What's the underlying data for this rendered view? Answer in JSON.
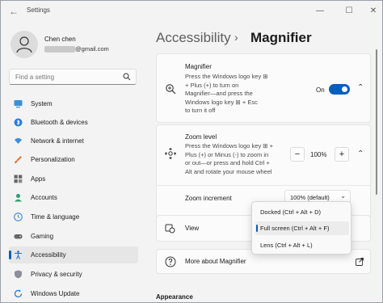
{
  "window": {
    "title": "Settings",
    "back_icon": "back-arrow-icon",
    "controls": [
      "minimize-icon",
      "maximize-icon",
      "close-icon"
    ]
  },
  "profile": {
    "name": "Chen chen",
    "email_suffix": "@gmail.com"
  },
  "search": {
    "placeholder": "Find a setting"
  },
  "nav": {
    "items": [
      {
        "label": "System",
        "icon": "monitor-icon"
      },
      {
        "label": "Bluetooth & devices",
        "icon": "bluetooth-icon"
      },
      {
        "label": "Network & internet",
        "icon": "wifi-icon"
      },
      {
        "label": "Personalization",
        "icon": "paintbrush-icon"
      },
      {
        "label": "Apps",
        "icon": "apps-icon"
      },
      {
        "label": "Accounts",
        "icon": "person-icon"
      },
      {
        "label": "Time & language",
        "icon": "globe-clock-icon"
      },
      {
        "label": "Gaming",
        "icon": "gamepad-icon"
      },
      {
        "label": "Accessibility",
        "icon": "accessibility-icon"
      },
      {
        "label": "Privacy & security",
        "icon": "shield-icon"
      },
      {
        "label": "Windows Update",
        "icon": "update-icon"
      }
    ],
    "active_index": 8
  },
  "breadcrumb": {
    "parent": "Accessibility",
    "separator": "›",
    "current": "Magnifier"
  },
  "magnifier": {
    "title": "Magnifier",
    "desc_lines": [
      "Press the Windows logo key ⊞",
      "+ Plus (+) to turn on",
      "Magnifier—and press the",
      "Windows logo key ⊞ + Esc",
      "to turn it off"
    ],
    "toggle_label": "On",
    "toggle_on": true
  },
  "zoom_level": {
    "title": "Zoom level",
    "desc_lines": [
      "Press the Windows logo key ⊞ +",
      "Plus (+) or Minus (-) to zoom in",
      "or out—or press and hold Ctrl +",
      "Alt and rotate your mouse wheel"
    ],
    "minus_label": "−",
    "value": "100%",
    "plus_label": "+"
  },
  "zoom_increment": {
    "label": "Zoom increment",
    "selected": "100% (default)"
  },
  "view": {
    "label": "View",
    "options": [
      "Docked (Ctrl + Alt + D)",
      "Full screen (Ctrl + Alt + F)",
      "Lens (Ctrl + Alt + L)"
    ],
    "selected_index": 1
  },
  "more_about": {
    "label": "More about Magnifier"
  },
  "appearance_heading": "Appearance",
  "accent_color": "#005fb8"
}
